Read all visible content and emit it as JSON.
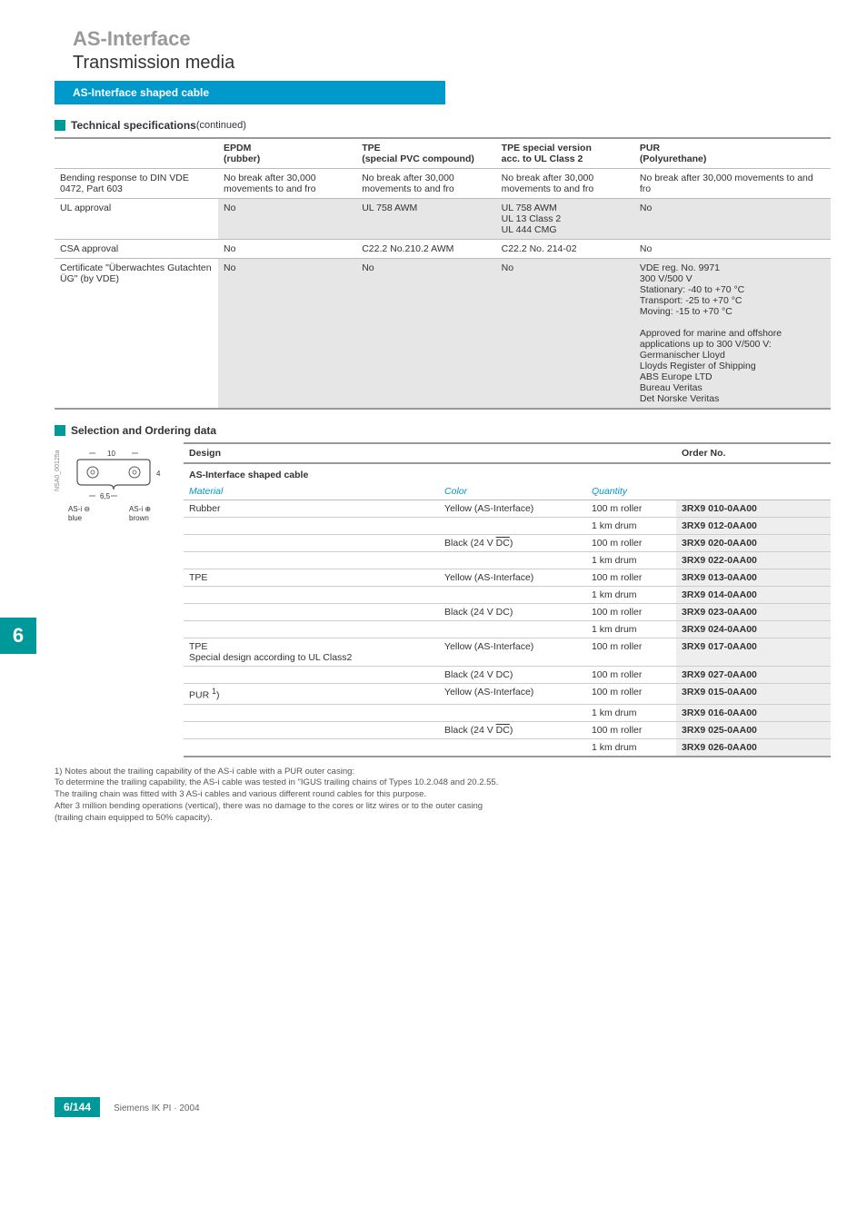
{
  "header": {
    "title": "AS-Interface",
    "subtitle": "Transmission media",
    "blueBar": "AS-Interface shaped cable"
  },
  "specSection": {
    "title": "Technical specifications",
    "suffix": " (continued)",
    "columns": [
      "",
      "EPDM\n(rubber)",
      "TPE\n(special PVC compound)",
      "TPE special version\nacc. to UL Class 2",
      "PUR\n(Polyurethane)"
    ],
    "rows": [
      {
        "label": "Bending response to DIN VDE 0472, Part 603",
        "cells": [
          "No break after 30,000 movements to and fro",
          "No break after 30,000 movements to and fro",
          "No break after 30,000 movements to and fro",
          "No break after 30,000 movements to and fro"
        ],
        "shaded": false
      },
      {
        "label": "UL approval",
        "cells": [
          "No",
          "UL 758 AWM",
          "UL 758 AWM\nUL 13 Class 2\nUL 444 CMG",
          "No"
        ],
        "shaded": true
      },
      {
        "label": "CSA approval",
        "cells": [
          "No",
          "C22.2 No.210.2 AWM",
          "C22.2 No. 214-02",
          "No"
        ],
        "shaded": false
      },
      {
        "label": "Certificate \"Überwachtes Gutachten ÜG\" (by VDE)",
        "cells": [
          "No",
          "No",
          "No",
          "VDE reg. No. 9971\n300 V/500 V\nStationary: -40 to +70 °C\nTransport: -25 to +70 °C\nMoving: -15 to +70 °C\n\nApproved for marine and offshore applications up to 300 V/500 V:\nGermanischer Lloyd\nLloyds Register of Shipping\nABS Europe LTD\nBureau Veritas\nDet Norske Veritas"
        ],
        "shaded": true
      }
    ]
  },
  "orderSection": {
    "title": "Selection and Ordering data",
    "designHeader": "Design",
    "orderHeader": "Order No.",
    "cableTitle": "AS-Interface shaped cable",
    "subheaders": {
      "material": "Material",
      "color": "Color",
      "quantity": "Quantity"
    },
    "rows": [
      {
        "material": "Rubber",
        "color": "Yellow (AS-Interface)",
        "qty": "100 m roller",
        "part": "3RX9 010-0AA00",
        "matStart": true,
        "colorStart": true
      },
      {
        "material": "",
        "color": "",
        "qty": "1 km drum",
        "part": "3RX9 012-0AA00"
      },
      {
        "material": "",
        "color": "Black (24 V DC)",
        "qty": "100 m roller",
        "part": "3RX9 020-0AA00",
        "colorStart": true,
        "dcOver": true
      },
      {
        "material": "",
        "color": "",
        "qty": "1 km drum",
        "part": "3RX9 022-0AA00"
      },
      {
        "material": "TPE",
        "color": "Yellow (AS-Interface)",
        "qty": "100 m roller",
        "part": "3RX9 013-0AA00",
        "matStart": true,
        "colorStart": true
      },
      {
        "material": "",
        "color": "",
        "qty": "1 km drum",
        "part": "3RX9 014-0AA00"
      },
      {
        "material": "",
        "color": "Black (24 V DC)",
        "qty": "100 m roller",
        "part": "3RX9 023-0AA00",
        "colorStart": true
      },
      {
        "material": "",
        "color": "",
        "qty": "1 km drum",
        "part": "3RX9 024-0AA00"
      },
      {
        "material": "TPE\nSpecial design according to UL Class2",
        "color": "Yellow (AS-Interface)",
        "qty": "100 m roller",
        "part": "3RX9 017-0AA00",
        "matStart": true,
        "colorStart": true
      },
      {
        "material": "",
        "color": "Black (24 V DC)",
        "qty": "100 m roller",
        "part": "3RX9 027-0AA00",
        "colorStart": true
      },
      {
        "material": "PUR 1)",
        "pur": true,
        "color": "Yellow (AS-Interface)",
        "qty": "100 m roller",
        "part": "3RX9 015-0AA00",
        "matStart": true,
        "colorStart": true
      },
      {
        "material": "",
        "color": "",
        "qty": "1 km drum",
        "part": "3RX9 016-0AA00"
      },
      {
        "material": "",
        "color": "Black (24 V DC)",
        "qty": "100 m roller",
        "part": "3RX9 025-0AA00",
        "colorStart": true,
        "dcOver": true
      },
      {
        "material": "",
        "color": "",
        "qty": "1 km drum",
        "part": "3RX9 026-0AA00"
      }
    ]
  },
  "diagram": {
    "sideLabel": "NSA0_00125a",
    "w10": "10",
    "w65": "6,5",
    "h4": "4",
    "asiMinus": "AS-i ⊖",
    "asiPlus": "AS-i ⊕",
    "blue": "blue",
    "brown": "brown"
  },
  "sideTab": "6",
  "notes": "1) Notes about the trailing capability of the AS-i cable with a PUR outer casing:\nTo determine the trailing capability, the AS-i cable was tested in \"IGUS trailing chains of Types 10.2.048 and 20.2.55.\nThe trailing chain was fitted with 3 AS-i cables and various different round cables for this purpose.\nAfter 3 million bending operations (vertical), there was no damage to the cores or litz wires or to the outer casing\n(trailing chain equipped to 50% capacity).",
  "footer": {
    "page": "6/144",
    "text": "Siemens IK PI · 2004"
  }
}
